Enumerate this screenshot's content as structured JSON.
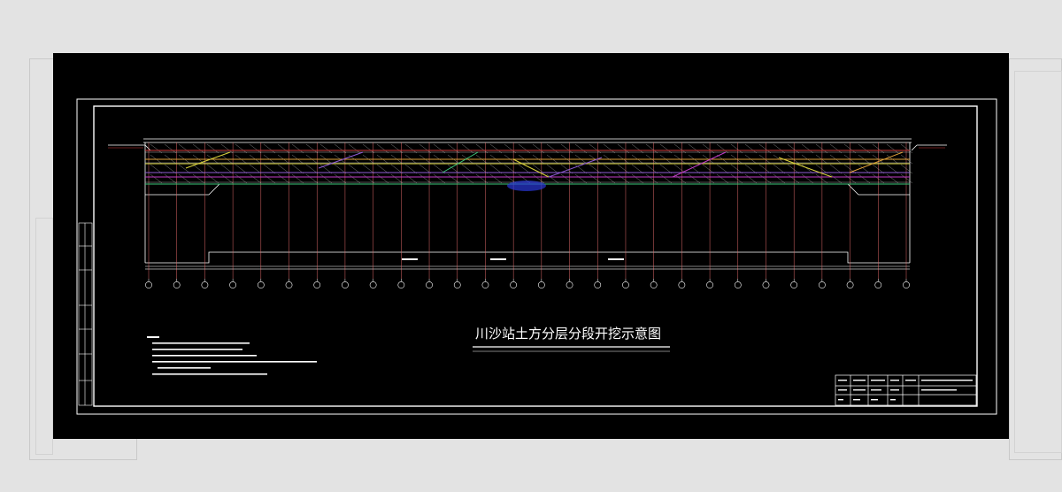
{
  "drawing": {
    "title": "川沙站土方分层分段开挖示意图"
  },
  "colors": {
    "background": "#000000",
    "frame": "#ffffff",
    "outline": "#ffffff",
    "row_lines": [
      "#e2a33a",
      "#d9d23c",
      "#8f5bd6",
      "#c23cc8",
      "#3cc87a",
      "#2a38d8",
      "#d23a3a",
      "#49d3d8"
    ]
  },
  "icons": [
    "zoom-icon"
  ]
}
